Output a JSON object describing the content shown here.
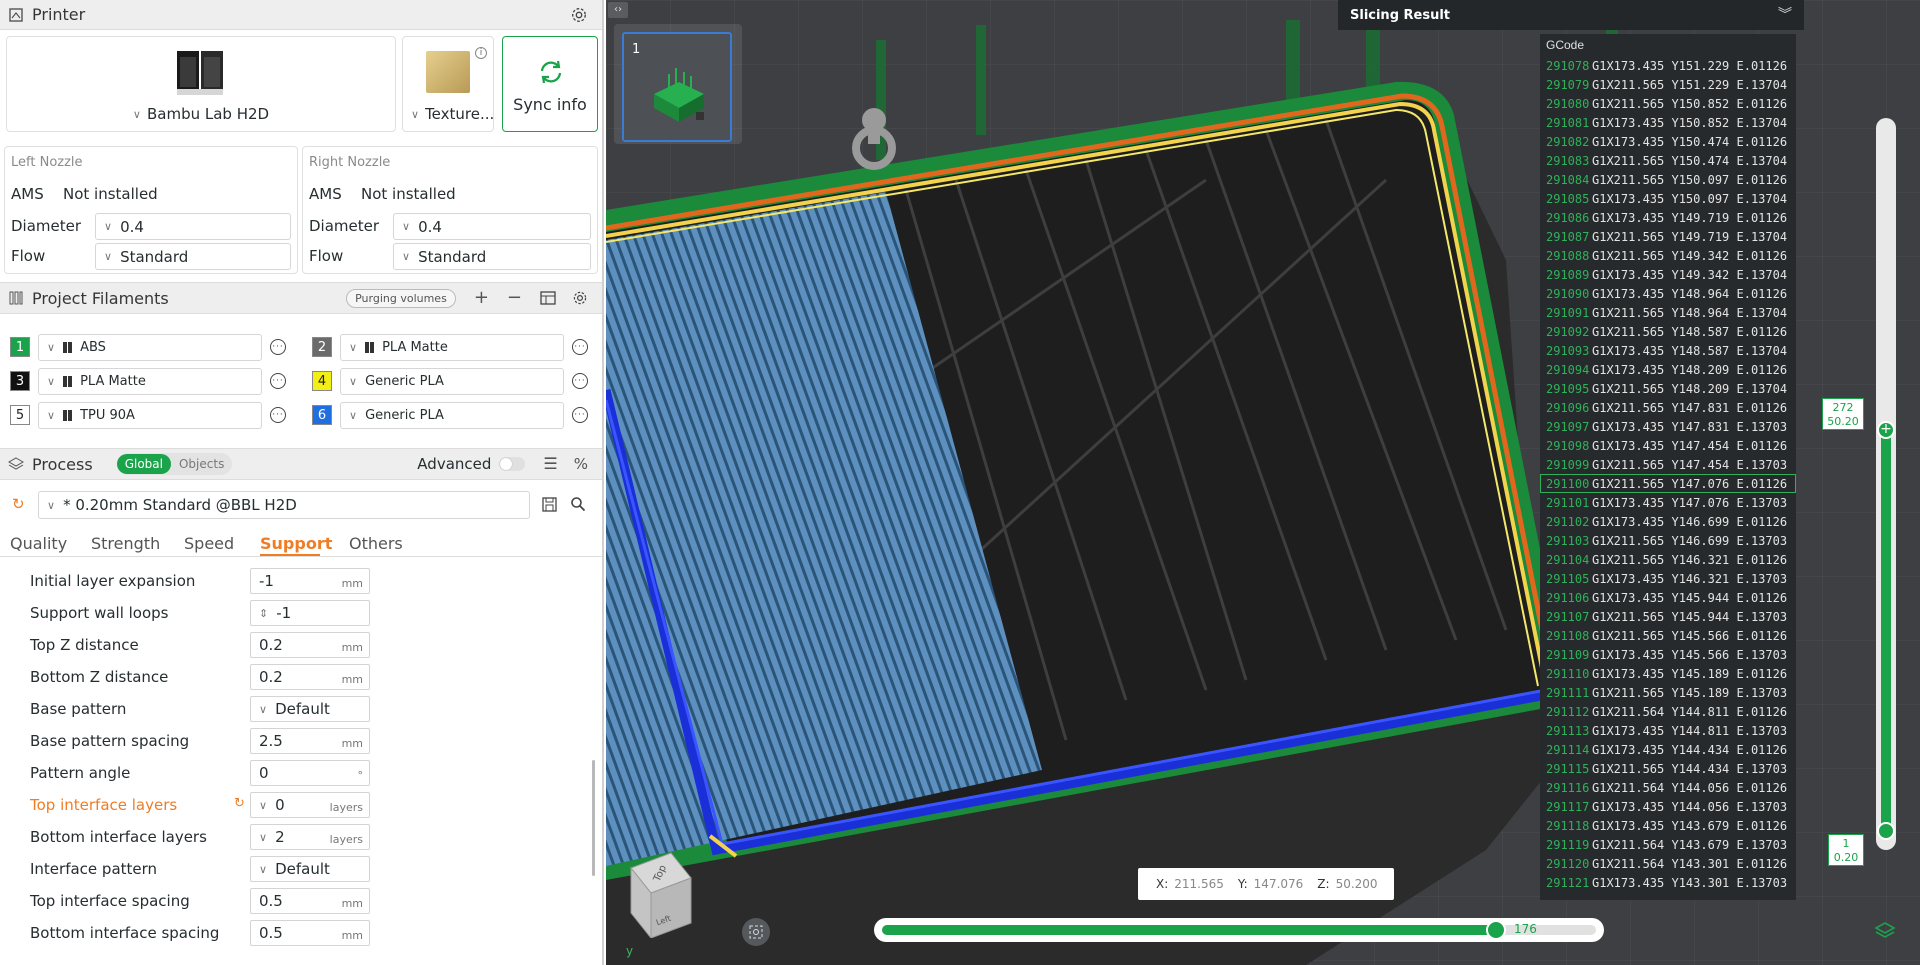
{
  "printer": {
    "title": "Printer",
    "model": "Bambu Lab H2D",
    "plate": "Texture...",
    "sync_label": "Sync info",
    "left_nozzle": {
      "title": "Left Nozzle",
      "ams_label": "AMS",
      "ams_value": "Not installed",
      "diameter_label": "Diameter",
      "diameter_value": "0.4",
      "flow_label": "Flow",
      "flow_value": "Standard"
    },
    "right_nozzle": {
      "title": "Right Nozzle",
      "ams_label": "AMS",
      "ams_value": "Not installed",
      "diameter_label": "Diameter",
      "diameter_value": "0.4",
      "flow_label": "Flow",
      "flow_value": "Standard"
    }
  },
  "filaments": {
    "title": "Project Filaments",
    "purge_label": "Purging volumes",
    "items": [
      {
        "num": "1",
        "name": "ABS",
        "color": "#1aa34a",
        "text_color": "#ffffff"
      },
      {
        "num": "2",
        "name": "PLA Matte",
        "color": "#6b6b6b",
        "text_color": "#ffffff"
      },
      {
        "num": "3",
        "name": "PLA Matte",
        "color": "#111111",
        "text_color": "#ffffff"
      },
      {
        "num": "4",
        "name": "Generic PLA",
        "color": "#f3ef16",
        "text_color": "#222222"
      },
      {
        "num": "5",
        "name": "TPU 90A",
        "color": "#ffffff",
        "text_color": "#222222"
      },
      {
        "num": "6",
        "name": "Generic PLA",
        "color": "#1f6fe0",
        "text_color": "#ffffff"
      }
    ]
  },
  "process": {
    "title": "Process",
    "global_label": "Global",
    "objects_label": "Objects",
    "advanced_label": "Advanced",
    "preset": "* 0.20mm Standard @BBL H2D",
    "tabs": [
      "Quality",
      "Strength",
      "Speed",
      "Support",
      "Others"
    ],
    "active_tab": "Support",
    "accent": "#f07c24",
    "settings": [
      {
        "label": "Initial layer expansion",
        "value": "-1",
        "unit": "mm"
      },
      {
        "label": "Support wall loops",
        "value": "-1",
        "unit": ""
      },
      {
        "label": "Top Z distance",
        "value": "0.2",
        "unit": "mm"
      },
      {
        "label": "Bottom Z distance",
        "value": "0.2",
        "unit": "mm"
      },
      {
        "label": "Base pattern",
        "value": "Default",
        "unit": ""
      },
      {
        "label": "Base pattern spacing",
        "value": "2.5",
        "unit": "mm"
      },
      {
        "label": "Pattern angle",
        "value": "0",
        "unit": "°"
      },
      {
        "label": "Top interface layers",
        "value": "0",
        "unit": "layers"
      },
      {
        "label": "Bottom interface layers",
        "value": "2",
        "unit": "layers"
      },
      {
        "label": "Interface pattern",
        "value": "Default",
        "unit": ""
      },
      {
        "label": "Top interface spacing",
        "value": "0.5",
        "unit": "mm"
      },
      {
        "label": "Bottom interface spacing",
        "value": "0.5",
        "unit": "mm"
      }
    ]
  },
  "viewport": {
    "plate_number": "1",
    "slicing_result_title": "Slicing Result",
    "gcode_header": "GCode",
    "coords": {
      "x_label": "X:",
      "x": "211.565",
      "y_label": "Y:",
      "y": "147.076",
      "z_label": "Z:",
      "z": "50.200"
    },
    "layer_top": {
      "layer": "272",
      "height": "50.20"
    },
    "layer_bottom": {
      "layer": "1",
      "height": "0.20"
    },
    "move_value": "176",
    "move_fraction": 0.86,
    "cube_top": "Top",
    "cube_left": "Left",
    "axis_y": "y"
  },
  "gcode": [
    {
      "n": "291078",
      "t": "G1X173.435 Y151.229 E.01126"
    },
    {
      "n": "291079",
      "t": "G1X211.565 Y151.229 E.13704"
    },
    {
      "n": "291080",
      "t": "G1X211.565 Y150.852 E.01126"
    },
    {
      "n": "291081",
      "t": "G1X173.435 Y150.852 E.13704"
    },
    {
      "n": "291082",
      "t": "G1X173.435 Y150.474 E.01126"
    },
    {
      "n": "291083",
      "t": "G1X211.565 Y150.474 E.13704"
    },
    {
      "n": "291084",
      "t": "G1X211.565 Y150.097 E.01126"
    },
    {
      "n": "291085",
      "t": "G1X173.435 Y150.097 E.13704"
    },
    {
      "n": "291086",
      "t": "G1X173.435 Y149.719 E.01126"
    },
    {
      "n": "291087",
      "t": "G1X211.565 Y149.719 E.13704"
    },
    {
      "n": "291088",
      "t": "G1X211.565 Y149.342 E.01126"
    },
    {
      "n": "291089",
      "t": "G1X173.435 Y149.342 E.13704"
    },
    {
      "n": "291090",
      "t": "G1X173.435 Y148.964 E.01126"
    },
    {
      "n": "291091",
      "t": "G1X211.565 Y148.964 E.13704"
    },
    {
      "n": "291092",
      "t": "G1X211.565 Y148.587 E.01126"
    },
    {
      "n": "291093",
      "t": "G1X173.435 Y148.587 E.13704"
    },
    {
      "n": "291094",
      "t": "G1X173.435 Y148.209 E.01126"
    },
    {
      "n": "291095",
      "t": "G1X211.565 Y148.209 E.13704"
    },
    {
      "n": "291096",
      "t": "G1X211.565 Y147.831 E.01126"
    },
    {
      "n": "291097",
      "t": "G1X173.435 Y147.831 E.13703"
    },
    {
      "n": "291098",
      "t": "G1X173.435 Y147.454 E.01126"
    },
    {
      "n": "291099",
      "t": "G1X211.565 Y147.454 E.13703"
    },
    {
      "n": "291100",
      "t": "G1X211.565 Y147.076 E.01126",
      "active": true
    },
    {
      "n": "291101",
      "t": "G1X173.435 Y147.076 E.13703"
    },
    {
      "n": "291102",
      "t": "G1X173.435 Y146.699 E.01126"
    },
    {
      "n": "291103",
      "t": "G1X211.565 Y146.699 E.13703"
    },
    {
      "n": "291104",
      "t": "G1X211.565 Y146.321 E.01126"
    },
    {
      "n": "291105",
      "t": "G1X173.435 Y146.321 E.13703"
    },
    {
      "n": "291106",
      "t": "G1X173.435 Y145.944 E.01126"
    },
    {
      "n": "291107",
      "t": "G1X211.565 Y145.944 E.13703"
    },
    {
      "n": "291108",
      "t": "G1X211.565 Y145.566 E.01126"
    },
    {
      "n": "291109",
      "t": "G1X173.435 Y145.566 E.13703"
    },
    {
      "n": "291110",
      "t": "G1X173.435 Y145.189 E.01126"
    },
    {
      "n": "291111",
      "t": "G1X211.565 Y145.189 E.13703"
    },
    {
      "n": "291112",
      "t": "G1X211.564 Y144.811 E.01126"
    },
    {
      "n": "291113",
      "t": "G1X173.435 Y144.811 E.13703"
    },
    {
      "n": "291114",
      "t": "G1X173.435 Y144.434 E.01126"
    },
    {
      "n": "291115",
      "t": "G1X211.565 Y144.434 E.13703"
    },
    {
      "n": "291116",
      "t": "G1X211.564 Y144.056 E.01126"
    },
    {
      "n": "291117",
      "t": "G1X173.435 Y144.056 E.13703"
    },
    {
      "n": "291118",
      "t": "G1X173.435 Y143.679 E.01126"
    },
    {
      "n": "291119",
      "t": "G1X211.564 Y143.679 E.13703"
    },
    {
      "n": "291120",
      "t": "G1X211.564 Y143.301 E.01126"
    },
    {
      "n": "291121",
      "t": "G1X173.435 Y143.301 E.13703"
    }
  ]
}
